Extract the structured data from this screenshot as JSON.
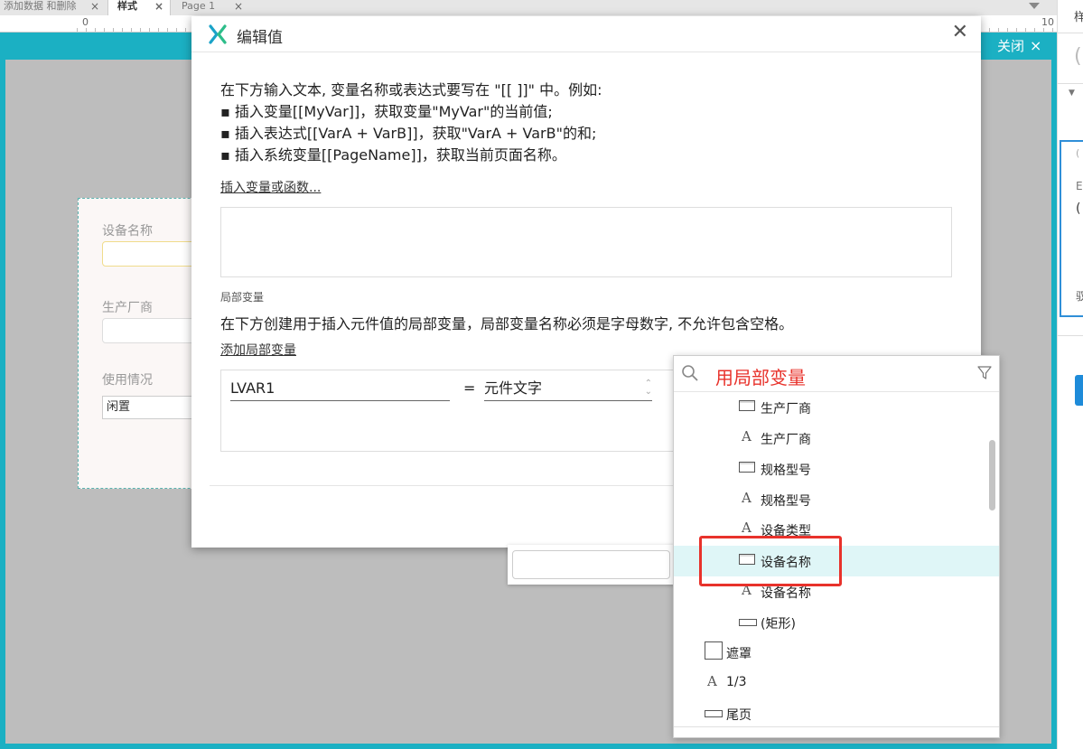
{
  "tabs": [
    {
      "label": "添加数据 和删除",
      "close": "×"
    },
    {
      "label": "样式",
      "close": "×"
    },
    {
      "label": "Page 1",
      "close": "×"
    }
  ],
  "ruler": {
    "start": "0",
    "end": "10"
  },
  "canvas": {
    "close_label": "关闭",
    "close_glyph": "×"
  },
  "form": {
    "device_name_label": "设备名称",
    "manufacturer_label": "生产厂商",
    "usage_label": "使用情况",
    "usage_value": "闲置"
  },
  "right_panel": {
    "tab_label": "样",
    "placeholder": "(",
    "arrow": "▼",
    "small_1": "(",
    "small_2": "E",
    "small_3": "(",
    "small_4": "驭"
  },
  "dialog": {
    "title": "编辑值",
    "close_glyph": "✕",
    "intro": "在下方输入文本, 变量名称或表达式要写在 \"[[ ]]\" 中。例如:\n▪ 插入变量[[MyVar]]，获取变量\"MyVar\"的当前值;\n▪ 插入表达式[[VarA + VarB]]，获取\"VarA + VarB\"的和;\n▪ 插入系统变量[[PageName]]，获取当前页面名称。",
    "insert_link": "插入变量或函数...",
    "local_section": "局部变量",
    "local_desc": "在下方创建用于插入元件值的局部变量，局部变量名称必须是字母数字, 不允许包含空格。",
    "add_local_link": "添加局部变量",
    "var_name": "LVAR1",
    "equals": "=",
    "var_type": "元件文字",
    "arrow_up": "⌃",
    "arrow_down": "⌄"
  },
  "dropdown": {
    "search_text": "用局部变量",
    "accent_color": "#e8322b",
    "items": [
      {
        "icon": "rect-icon",
        "label": "生产厂商"
      },
      {
        "icon": "text-a-icon",
        "label": "生产厂商"
      },
      {
        "icon": "rect-icon",
        "label": "规格型号"
      },
      {
        "icon": "text-a-icon",
        "label": "规格型号"
      },
      {
        "icon": "text-a-icon",
        "label": "设备类型"
      },
      {
        "icon": "rect-icon",
        "label": "设备名称",
        "selected": true
      },
      {
        "icon": "text-a-icon",
        "label": "设备名称"
      },
      {
        "icon": "flat-rect-icon",
        "label": "(矩形)"
      },
      {
        "icon": "square-icon",
        "label": "遮罩"
      },
      {
        "icon": "text-a-icon",
        "label": "1/3"
      },
      {
        "icon": "flat-rect-icon",
        "label": "尾页"
      }
    ]
  }
}
